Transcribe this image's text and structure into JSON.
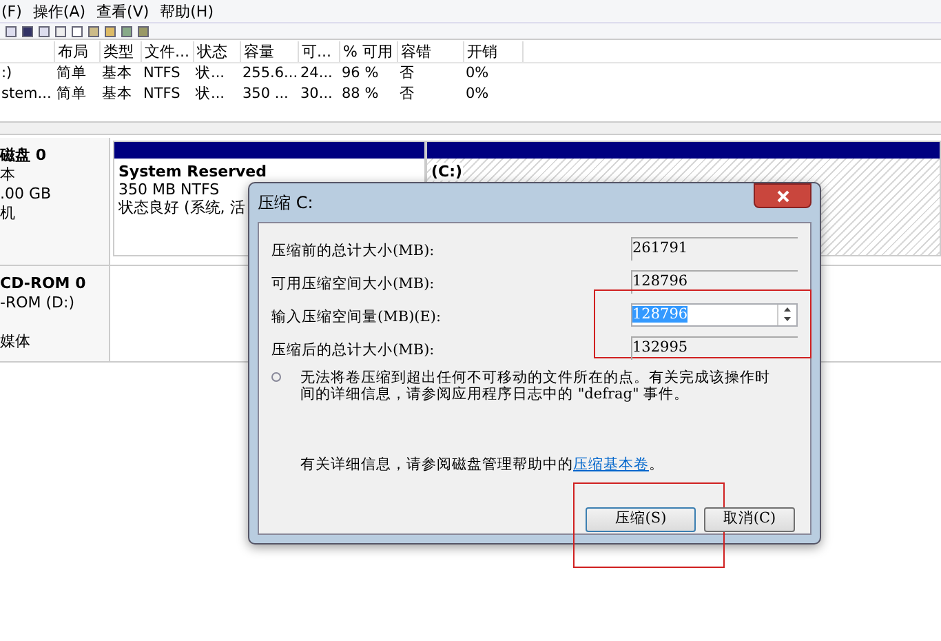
{
  "menu": [
    "(F)",
    "操作(A)",
    "查看(V)",
    "帮助(H)"
  ],
  "table": {
    "columns": [
      "",
      "布局",
      "类型",
      "文件...",
      "状态",
      "容量",
      "可...",
      "% 可用",
      "容错",
      "开销"
    ],
    "rows": [
      [
        ":)",
        "简单",
        "基本",
        "NTFS",
        "状...",
        "255.6...",
        "24...",
        "96 %",
        "否",
        "0%"
      ],
      [
        "stem...",
        "简单",
        "基本",
        "NTFS",
        "状...",
        "350 ...",
        "30...",
        "88 %",
        "否",
        "0%"
      ]
    ]
  },
  "disks": [
    {
      "kind": "basic",
      "lines": [
        "磁盘 0",
        "本",
        ".00 GB"
      ],
      "status": "机",
      "partitions": [
        {
          "kind": "normal",
          "lines": [
            "System Reserved",
            "350 MB NTFS",
            "状态良好 (系统, 活"
          ]
        },
        {
          "kind": "hatched",
          "lines": [
            "(C:)"
          ]
        }
      ]
    },
    {
      "kind": "cdrom",
      "lines": [
        "CD-ROM 0",
        "-ROM (D:)"
      ],
      "status": "媒体"
    }
  ],
  "dialog": {
    "title": "压缩 C:",
    "fields": [
      {
        "kind": "readonly",
        "label": "压缩前的总计大小(MB):",
        "value": "261791",
        "highlight": false
      },
      {
        "kind": "readonly",
        "label": "可用压缩空间大小(MB):",
        "value": "128796",
        "highlight": false
      },
      {
        "kind": "spinner",
        "label": "输入压缩空间量(MB)(E):",
        "value": "128796",
        "highlight": true
      },
      {
        "kind": "readonly",
        "label": "压缩后的总计大小(MB):",
        "value": "132995",
        "highlight": false
      }
    ],
    "note": "无法将卷压缩到超出任何不可移动的文件所在的点。有关完成该操作时间的详细信息，请参阅应用程序日志中的 \"defrag\" 事件。",
    "help_text": "有关详细信息，请参阅磁盘管理帮助中的",
    "help_link": "压缩基本卷",
    "help_end": "。",
    "buttons": [
      {
        "label": "压缩(S)",
        "default": true,
        "highlight": true
      },
      {
        "label": "取消(C)",
        "default": false,
        "highlight": false
      }
    ]
  }
}
